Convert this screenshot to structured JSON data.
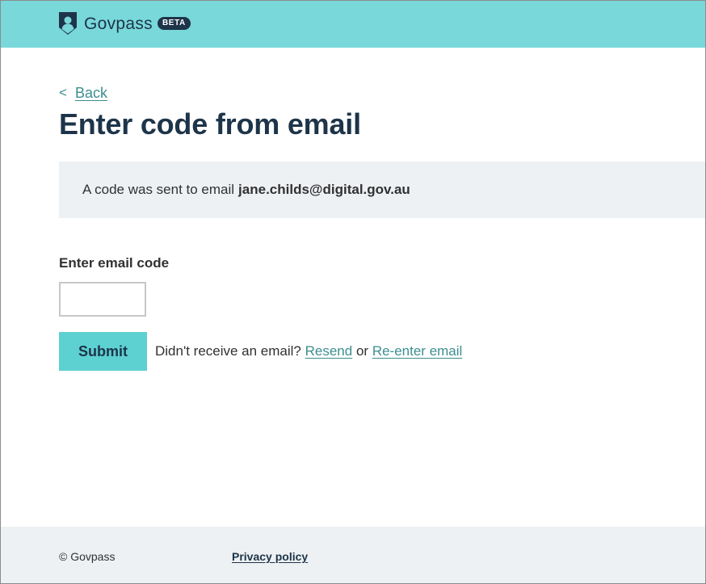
{
  "header": {
    "brand_name": "Govpass",
    "badge": "BETA",
    "logo_icon": "shield-person-icon",
    "background": "#79d8d9"
  },
  "main": {
    "back_chevron": "<",
    "back_label": "Back",
    "title": "Enter code from email",
    "notice": {
      "prefix": "A code was sent to email",
      "email": "jane.childs@digital.gov.au"
    },
    "code_field": {
      "label": "Enter email code",
      "value": "",
      "placeholder": ""
    },
    "submit_label": "Submit",
    "resend": {
      "prompt": "Didn't receive an email?",
      "resend_label": "Resend",
      "or_text": "or",
      "reenter_label": "Re-enter email"
    }
  },
  "footer": {
    "copyright": "© Govpass",
    "privacy_label": "Privacy policy"
  },
  "colors": {
    "accent": "#5dd1d1",
    "header_bg": "#79d8d9",
    "link": "#3c8e8f",
    "heading": "#1d3449",
    "panel_bg": "#eef1f4"
  }
}
